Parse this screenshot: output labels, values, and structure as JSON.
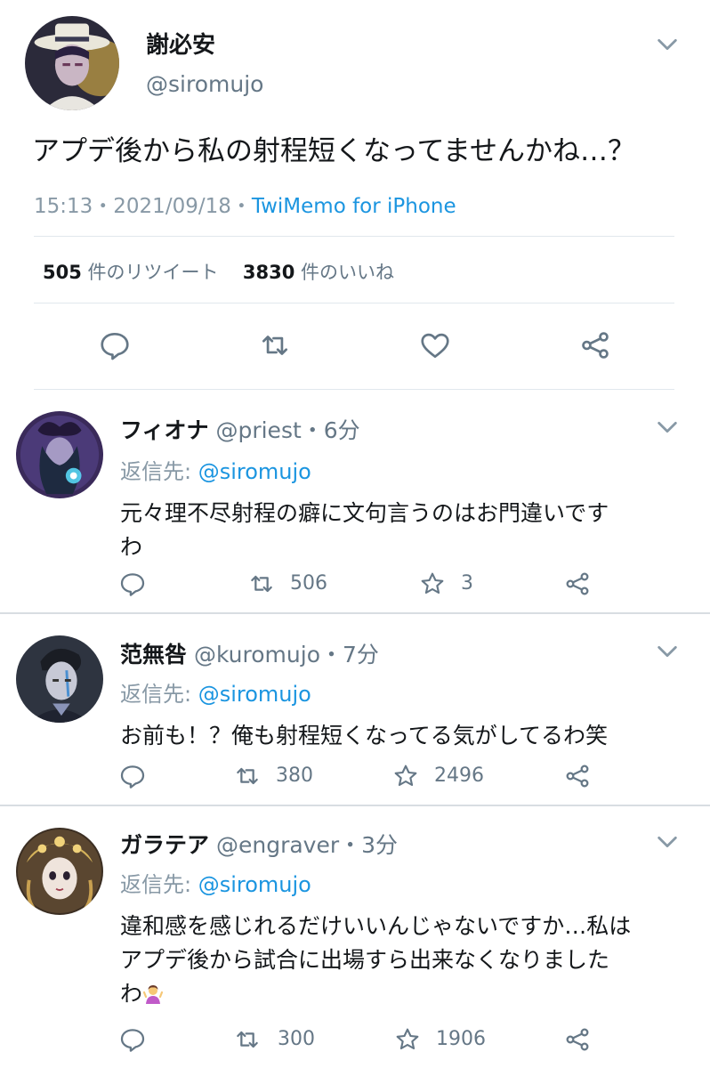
{
  "main": {
    "name": "謝必安",
    "handle": "@siromujo",
    "text": "アプデ後から私の射程短くなってませんかね…？",
    "time": "15:13・2021/09/18・",
    "source": "TwiMemo for iPhone",
    "retweets_count": "505",
    "retweets_label": "件のリツイート",
    "likes_count": "3830",
    "likes_label": "件のいいね"
  },
  "replies": [
    {
      "name": "フィオナ",
      "handle_time": "@priest・6分",
      "reply_to_label": "返信先: ",
      "reply_to": "@siromujo",
      "text_line1": "元々理不尽射程の癖に文句言うのはお門違いです",
      "text_line2": "わ",
      "retweets": "506",
      "likes": "3"
    },
    {
      "name": "范無咎",
      "handle_time": "@kuromujo・7分",
      "reply_to_label": "返信先: ",
      "reply_to": "@siromujo",
      "text_line1": "お前も！？俺も射程短くなってる気がしてるわ笑",
      "retweets": "380",
      "likes": "2496"
    },
    {
      "name": "ガラテア",
      "handle_time": "@engraver・3分",
      "reply_to_label": "返信先: ",
      "reply_to": "@siromujo",
      "text_line1": "違和感を感じれるだけいいんじゃないですか…私は",
      "text_line2": "アプデ後から試合に出場すら出来なくなりました",
      "text_line3": "わ",
      "emoji": "person-shrugging-emoji",
      "retweets": "300",
      "likes": "1906"
    }
  ],
  "icons": {
    "reply": "reply-icon",
    "retweet": "retweet-icon",
    "like": "heart-icon",
    "star": "star-icon",
    "share": "share-icon",
    "caret": "chevron-down-icon"
  },
  "colors": {
    "link": "#1b95e0",
    "muted": "#657786",
    "divider": "#e1e8ed"
  }
}
